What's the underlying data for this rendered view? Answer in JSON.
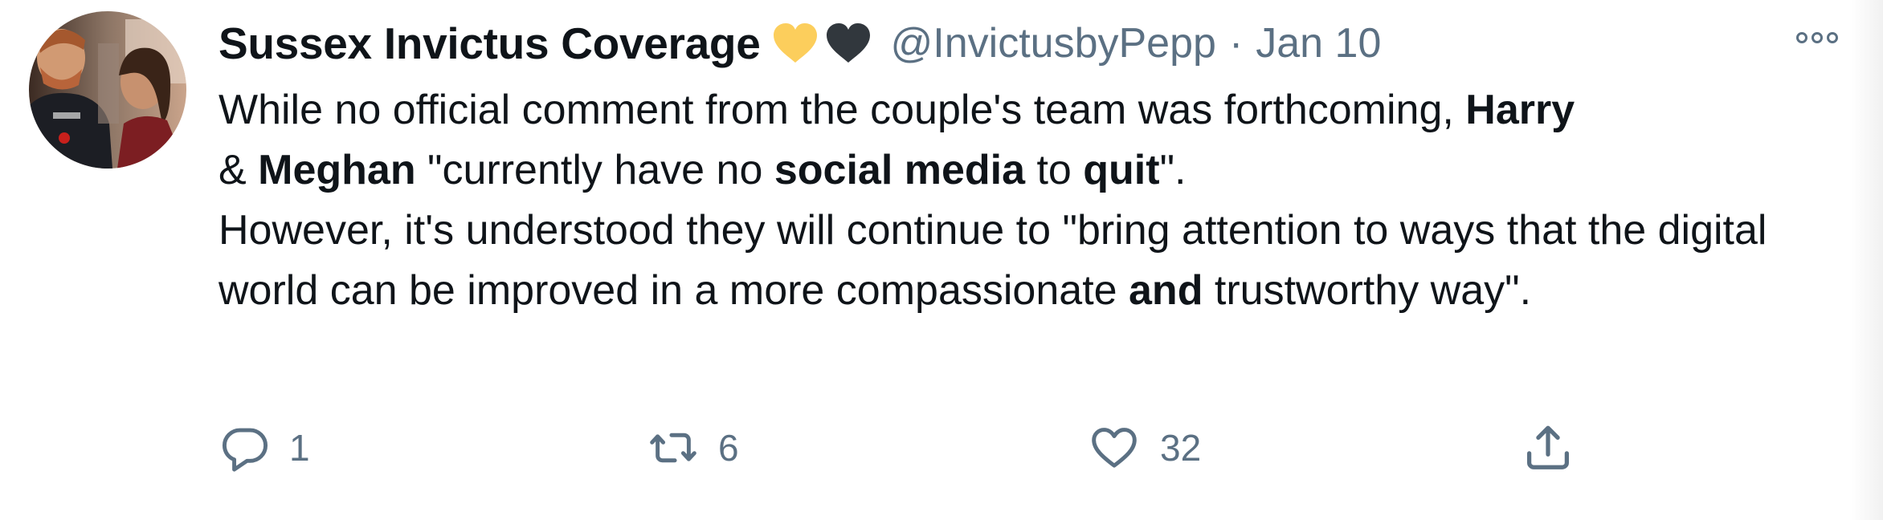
{
  "tweet": {
    "author": {
      "display_name": "Sussex Invictus Coverage",
      "handle": "@InvictusbyPepp",
      "name_emojis": [
        "yellow-heart",
        "black-heart"
      ]
    },
    "separator": "·",
    "date": "Jan 10",
    "more_icon": "more-icon",
    "body": {
      "line1_a": "While no official comment from the couple's team was forthcoming, ",
      "line1_bold_harry": "Harry",
      "line2_amp": "& ",
      "line2_bold_meghan": "Meghan",
      "line2_b": " \"currently have no ",
      "line2_bold_social": "social media",
      "line2_c": " to ",
      "line2_bold_quit": "quit",
      "line2_d": "\".",
      "para2_a": "However, it's understood they will continue to \"bring attention to ways that the digital world can be improved in a more compassionate ",
      "para2_bold_and": "and",
      "para2_b": " trustworthy way\"."
    },
    "actions": {
      "reply": {
        "icon": "reply-icon",
        "count": "1"
      },
      "retweet": {
        "icon": "retweet-icon",
        "count": "6"
      },
      "like": {
        "icon": "heart-icon",
        "count": "32"
      },
      "share": {
        "icon": "share-icon"
      }
    },
    "colors": {
      "text": "#0f1419",
      "secondary": "#5b7083",
      "yellow_heart": "#fcce5c",
      "black_heart": "#31373d"
    }
  }
}
